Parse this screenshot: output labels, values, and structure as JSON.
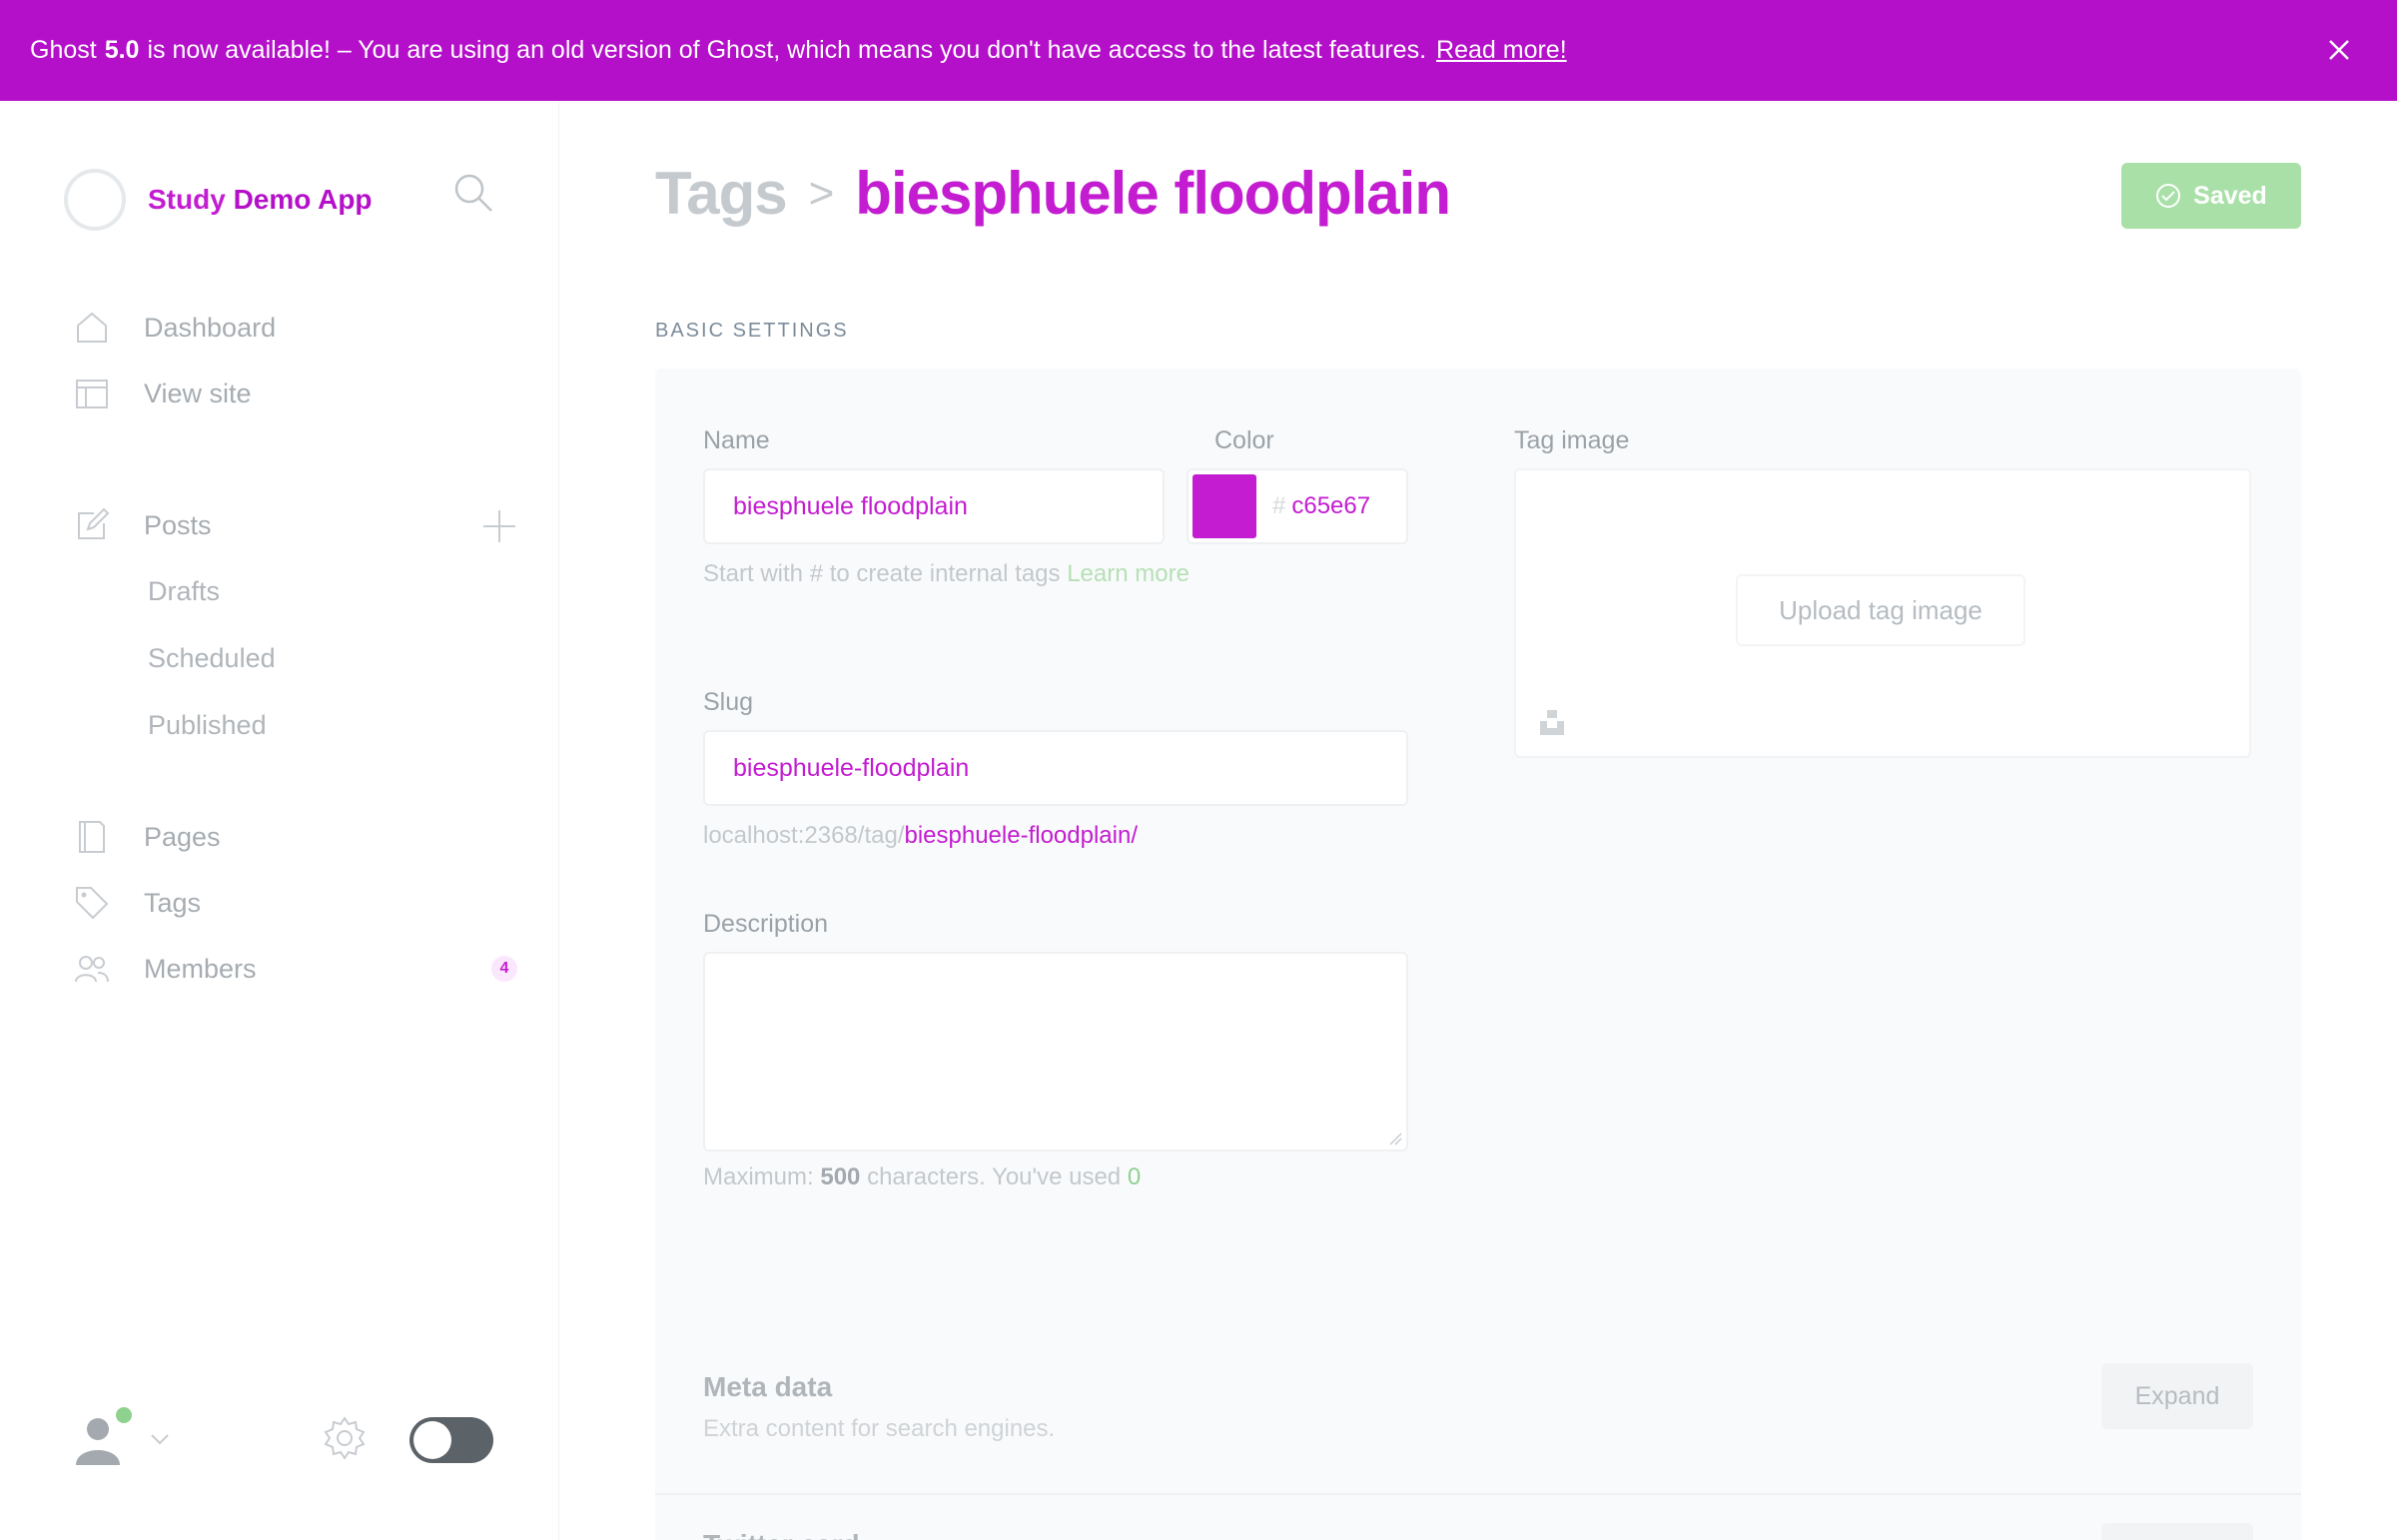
{
  "banner": {
    "prefix": "Ghost",
    "version": "5.0",
    "middle": "is now available!",
    "rest": "– You are using an old version of Ghost, which means you don't have access to the latest features.",
    "link": "Read more!"
  },
  "brand": {
    "name_prefix": "Study",
    "name": "Demo App"
  },
  "nav": {
    "dashboard": "Dashboard",
    "view_site": "View site",
    "posts": "Posts",
    "drafts": "Drafts",
    "scheduled": "Scheduled",
    "published": "Published",
    "pages": "Pages",
    "tags": "Tags",
    "members": "Members",
    "members_badge": "4"
  },
  "header": {
    "breadcrumb": "Tags",
    "separator": ">",
    "tag_name": "biesphuele floodplain",
    "saved_label": "Saved"
  },
  "section": {
    "basic_settings": "BASIC SETTINGS"
  },
  "form": {
    "name_label": "Name",
    "name_value": "biesphuele floodplain",
    "name_hint": "Start with # to create internal tags",
    "name_hint_link": "Learn more",
    "color_label": "Color",
    "color_hash": "#",
    "color_value": "c65e67",
    "color_swatch": "#c31cd1",
    "tag_image_label": "Tag image",
    "upload_label": "Upload tag image",
    "slug_label": "Slug",
    "slug_value": "biesphuele-floodplain",
    "slug_url_prefix": "localhost:2368/tag/",
    "slug_url_tag": "biesphuele-floodplain/",
    "description_label": "Description",
    "description_value": "",
    "counter_prefix": "Maximum:",
    "counter_max": "500",
    "counter_mid": "characters. You've used",
    "counter_used": "0"
  },
  "meta": {
    "title": "Meta data",
    "subtitle": "Extra content for search engines.",
    "expand": "Expand",
    "twitter_title": "Twitter card"
  },
  "colors": {
    "banner": "#b40fc9",
    "accent": "#c31cd1",
    "saved_green": "#a8e0a8"
  },
  "icons": [
    "close-icon",
    "search-icon",
    "home-icon",
    "window-icon",
    "edit-icon",
    "plus-icon",
    "page-icon",
    "tag-icon",
    "members-icon",
    "avatar-icon",
    "chevron-down-icon",
    "gear-icon",
    "check-icon",
    "unsplash-icon"
  ]
}
